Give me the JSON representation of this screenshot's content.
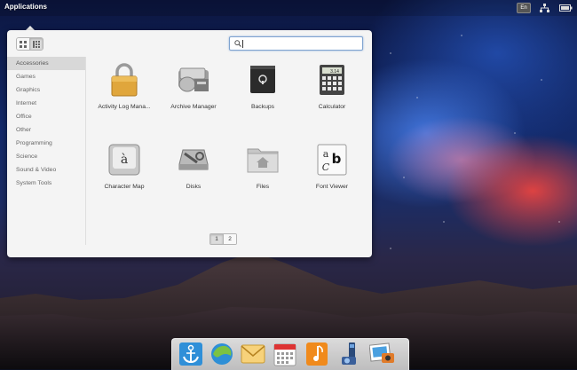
{
  "top_panel": {
    "applications_label": "Applications",
    "keyboard_layout": "En",
    "indicators": [
      "keyboard-layout-icon",
      "network-icon",
      "battery-icon"
    ]
  },
  "menu": {
    "view_modes": [
      "grid-view-icon",
      "category-view-icon"
    ],
    "active_view": "category-view",
    "search": {
      "value": "",
      "placeholder": ""
    },
    "categories": [
      "Accessories",
      "Games",
      "Graphics",
      "Internet",
      "Office",
      "Other",
      "Programming",
      "Science",
      "Sound & Video",
      "System Tools"
    ],
    "selected_category": "Accessories",
    "apps": [
      {
        "label": "Activity Log Mana...",
        "icon": "padlock-icon"
      },
      {
        "label": "Archive Manager",
        "icon": "archive-icon"
      },
      {
        "label": "Backups",
        "icon": "safe-icon"
      },
      {
        "label": "Calculator",
        "icon": "calculator-icon"
      },
      {
        "label": "Character Map",
        "icon": "key-a-icon"
      },
      {
        "label": "Disks",
        "icon": "disk-utility-icon"
      },
      {
        "label": "Files",
        "icon": "home-folder-icon"
      },
      {
        "label": "Font Viewer",
        "icon": "font-viewer-icon"
      }
    ],
    "calculator_display": "3.14",
    "charmap_glyph": "à",
    "font_viewer_glyphs": [
      "a",
      "b",
      "C"
    ],
    "pages": [
      "1",
      "2"
    ],
    "current_page": "1"
  },
  "dock": {
    "items": [
      "docky-anchor-icon",
      "midori-browser-icon",
      "mail-icon",
      "calendar-icon",
      "music-icon",
      "videos-icon",
      "photos-icon"
    ]
  },
  "colors": {
    "menu_bg": "#f4f4f4",
    "selected_category_bg": "#d8d8d8",
    "search_focus_border": "#7fa3d0"
  }
}
